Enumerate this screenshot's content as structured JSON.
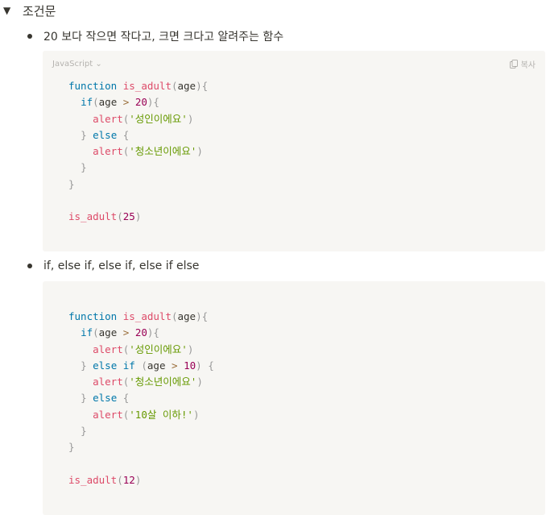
{
  "toggle": {
    "arrow": "▼",
    "title": "조건문"
  },
  "bullets": [
    "20 보다 작으면 작다고, 크면 크다고 알려주는 함수",
    "if, else if, else if, else if else"
  ],
  "code_block_1": {
    "language": "JavaScript",
    "copy_label": "복사",
    "tokens": {
      "fn_kw": "function",
      "fn_name": "is_adult",
      "param": "age",
      "if_kw": "if",
      "if_var": "age",
      "gt": ">",
      "num_20": "20",
      "alert_1": "alert",
      "str_adult": "'성인이에요'",
      "else_kw": "else",
      "alert_2": "alert",
      "str_teen": "'청소년이에요'",
      "call_name": "is_adult",
      "call_arg": "25"
    }
  },
  "code_block_2": {
    "tokens": {
      "fn_kw": "function",
      "fn_name": "is_adult",
      "param": "age",
      "if_kw": "if",
      "if_var": "age",
      "gt": ">",
      "num_20": "20",
      "alert_1": "alert",
      "str_adult": "'성인이에요'",
      "else_kw": "else",
      "elseif_if": "if",
      "elseif_var": "age",
      "gt2": ">",
      "num_10": "10",
      "alert_2": "alert",
      "str_teen": "'청소년이에요'",
      "else_kw2": "else",
      "alert_3": "alert",
      "str_under": "'10살 이하!'",
      "call_name": "is_adult",
      "call_arg": "12"
    }
  }
}
